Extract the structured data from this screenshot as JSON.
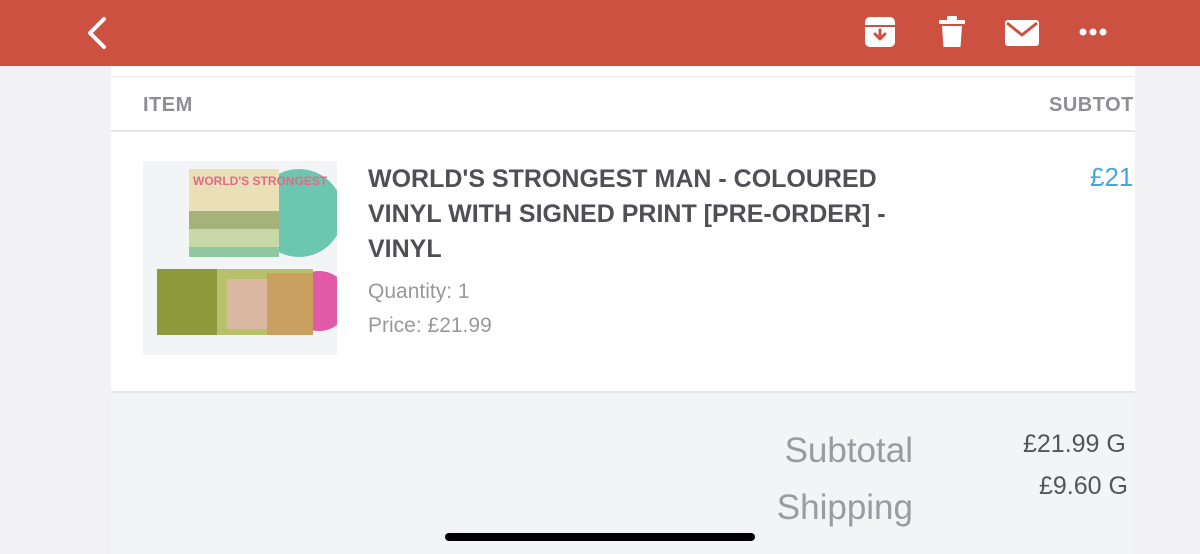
{
  "toolbar": {
    "back_icon": "chevron-left-icon",
    "archive_icon": "archive-icon",
    "delete_icon": "trash-icon",
    "mark_unread_icon": "mail-icon",
    "more_icon": "more-horizontal-icon",
    "bar_color": "#cc5140"
  },
  "table": {
    "col_item": "ITEM",
    "col_subtotal": "SUBTOT"
  },
  "line_item": {
    "title": "WORLD'S STRONGEST MAN - COLOURED VINYL WITH SIGNED PRINT [PRE-ORDER] - VINYL",
    "quantity": "Quantity: 1",
    "price": "Price: £21.99",
    "subtotal": "£21",
    "image_text": "WORLD'S STRONGEST",
    "subtotal_color": "#45a8d8"
  },
  "summary": {
    "subtotal_label": "Subtotal",
    "subtotal_value": "£21.99 G",
    "shipping_label": "Shipping",
    "shipping_value": "£9.60 G"
  }
}
